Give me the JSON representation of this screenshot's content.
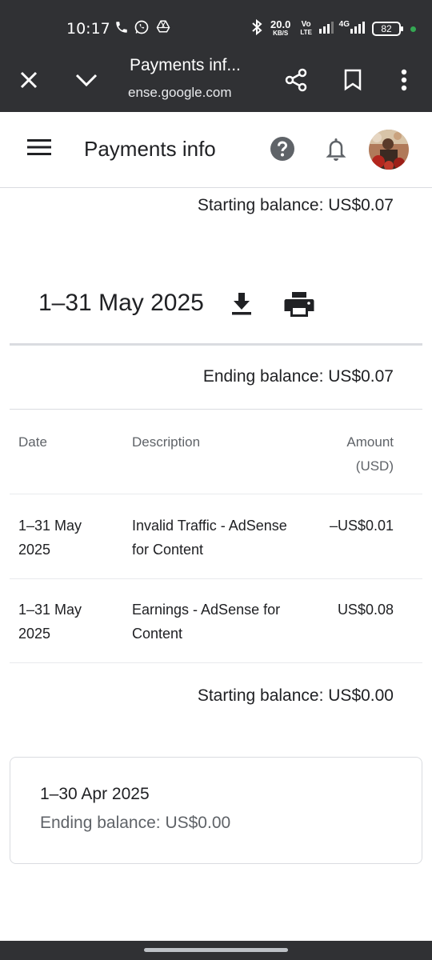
{
  "status_bar": {
    "time": "10:17",
    "net_speed": "20.0",
    "net_unit": "KB/S",
    "volte_top": "Vo",
    "volte_bottom": "LTE",
    "network_type": "4G",
    "battery": "82",
    "icons": [
      "phone-icon",
      "whatsapp-icon",
      "drive-icon",
      "bluetooth-icon",
      "signal-icon",
      "battery-icon"
    ]
  },
  "browser_tab": {
    "title": "Payments inf...",
    "url": "ense.google.com",
    "icons": [
      "close-icon",
      "chevron-down-icon",
      "share-icon",
      "bookmark-icon",
      "more-vert-icon"
    ]
  },
  "app_header": {
    "title": "Payments info",
    "icons": [
      "menu-icon",
      "help-icon",
      "notifications-icon",
      "avatar"
    ]
  },
  "statement": {
    "top_starting_balance": "Starting balance: US$0.07",
    "period": "1–31 May 2025",
    "ending_balance": "Ending balance: US$0.07",
    "columns": {
      "date": "Date",
      "description": "Description",
      "amount_line1": "Amount",
      "amount_line2": "(USD)"
    },
    "rows": [
      {
        "date_line1": "1–31 May",
        "date_line2": "2025",
        "desc_line1": "Invalid Traffic - AdSense",
        "desc_line2": "for Content",
        "amount": "–US$0.01"
      },
      {
        "date_line1": "1–31 May",
        "date_line2": "2025",
        "desc_line1": "Earnings - AdSense for",
        "desc_line2": "Content",
        "amount": "US$0.08"
      }
    ],
    "starting_balance": "Starting balance: US$0.00"
  },
  "previous_period": {
    "title": "1–30 Apr 2025",
    "ending_balance": "Ending balance: US$0.00"
  },
  "colors": {
    "chrome_dark": "#303134",
    "text_primary": "#202124",
    "text_secondary": "#5f6368",
    "divider": "#dadce0",
    "status_dot": "#34a853"
  }
}
